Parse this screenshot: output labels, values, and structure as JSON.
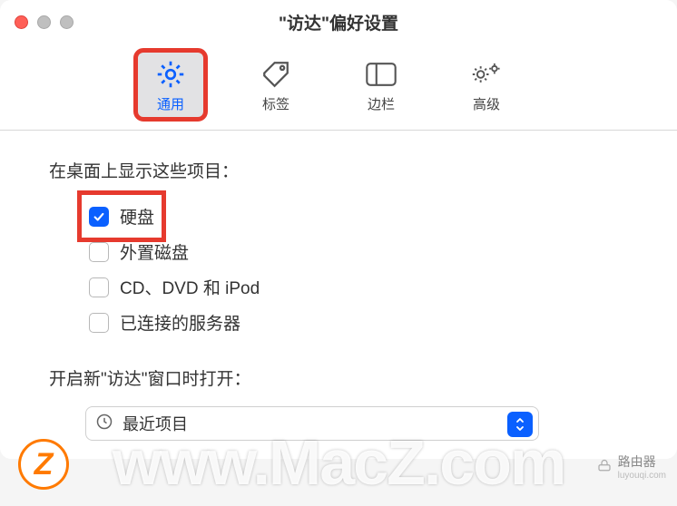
{
  "window": {
    "title": "\"访达\"偏好设置"
  },
  "toolbar": {
    "items": [
      {
        "label": "通用",
        "icon": "gear",
        "selected": true
      },
      {
        "label": "标签",
        "icon": "tag",
        "selected": false
      },
      {
        "label": "边栏",
        "icon": "sidebar",
        "selected": false
      },
      {
        "label": "高级",
        "icon": "gears",
        "selected": false
      }
    ]
  },
  "content": {
    "section_label": "在桌面上显示这些项目：",
    "checkboxes": [
      {
        "label": "硬盘",
        "checked": true,
        "highlight": true
      },
      {
        "label": "外置磁盘",
        "checked": false,
        "highlight": false
      },
      {
        "label": "CD、DVD 和 iPod",
        "checked": false,
        "highlight": false
      },
      {
        "label": "已连接的服务器",
        "checked": false,
        "highlight": false
      }
    ],
    "section2_label": "开启新\"访达\"窗口时打开：",
    "dropdown": {
      "selected": "最近项目",
      "icon": "clock"
    }
  },
  "watermark": {
    "main": "www.MacZ.com",
    "badge": "Z",
    "right": "路由器",
    "right_sub": "luyouqi.com"
  },
  "colors": {
    "accent": "#0a60ff",
    "highlight": "#e63a2e"
  }
}
